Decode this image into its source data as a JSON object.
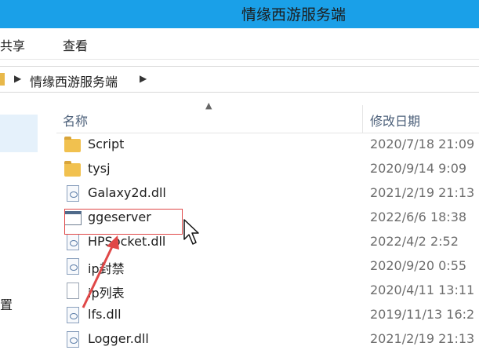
{
  "window": {
    "title": "情缘西游服务端"
  },
  "ribbon": {
    "tabs": [
      "共享",
      "查看"
    ]
  },
  "address": {
    "breadcrumb": "情缘西游服务端"
  },
  "navpane": {
    "partial_label": "置"
  },
  "columns": {
    "name": "名称",
    "date": "修改日期"
  },
  "files": [
    {
      "icon": "folder-icon",
      "name": "Script",
      "date": "2020/7/18 21:09"
    },
    {
      "icon": "folder-icon",
      "name": "tysj",
      "date": "2020/9/14 9:09"
    },
    {
      "icon": "dll-file-icon",
      "name": "Galaxy2d.dll",
      "date": "2021/2/19 21:13"
    },
    {
      "icon": "exe-file-icon",
      "name": "ggeserver",
      "date": "2022/6/6 18:38"
    },
    {
      "icon": "dll-file-icon",
      "name": "HPSocket.dll",
      "date": "2022/4/2 2:52"
    },
    {
      "icon": "settings-file-icon",
      "name": "ip封禁",
      "date": "2020/9/20 0:55"
    },
    {
      "icon": "text-file-icon",
      "name": "ip列表",
      "date": "2020/4/11 13:11"
    },
    {
      "icon": "dll-file-icon",
      "name": "lfs.dll",
      "date": "2019/11/13 16:2"
    },
    {
      "icon": "dll-file-icon",
      "name": "Logger.dll",
      "date": "2021/2/19 21:13"
    }
  ],
  "colors": {
    "titlebar": "#1aa0e8",
    "highlight": "#e04848",
    "folder": "#f1c14f"
  }
}
